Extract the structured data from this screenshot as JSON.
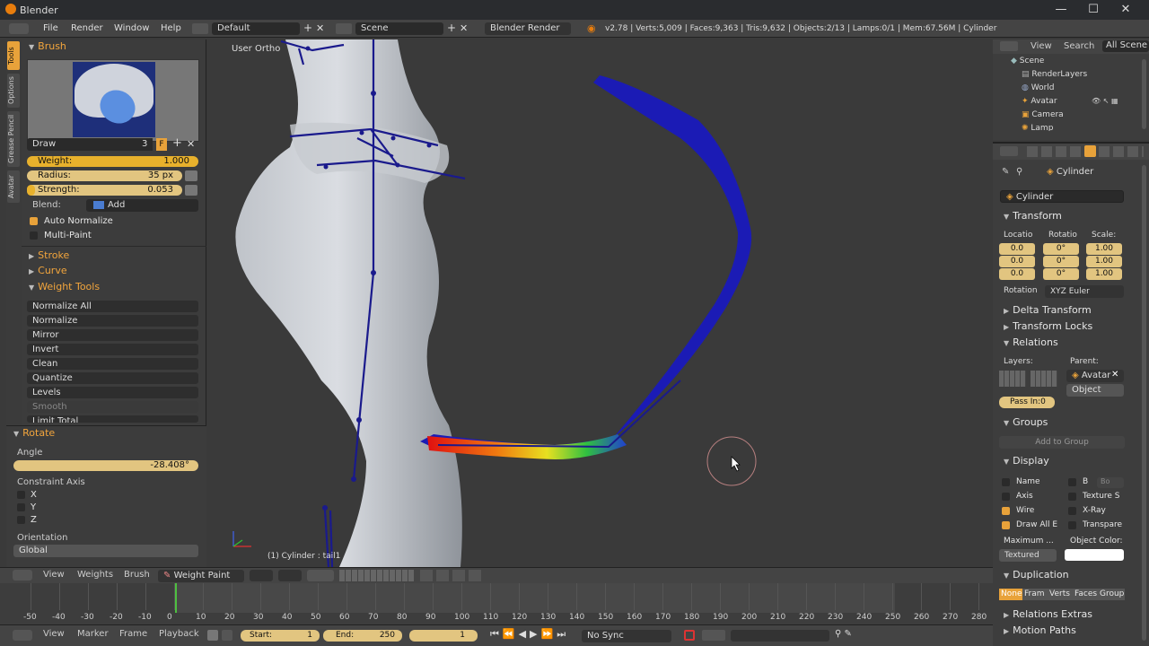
{
  "window": {
    "title": "Blender",
    "minimize": "—",
    "maximize": "☐",
    "close": "✕"
  },
  "topmenu": {
    "items": [
      "File",
      "Render",
      "Window",
      "Help"
    ],
    "layout": "Default",
    "scene": "Scene",
    "engine": "Blender Render",
    "stats": "v2.78 | Verts:5,009 | Faces:9,363 | Tris:9,632 | Objects:2/13 | Lamps:0/1 | Mem:67.56M | Cylinder"
  },
  "lefttabs": [
    "Tools",
    "Options",
    "Grease Pencil",
    "Avatar"
  ],
  "brush": {
    "header": "Brush",
    "name": "Draw",
    "users": "3",
    "fake": "F",
    "weight_label": "Weight:",
    "weight_value": "1.000",
    "weight_fill": 1.0,
    "radius_label": "Radius:",
    "radius_value": "35 px",
    "strength_label": "Strength:",
    "strength_value": "0.053",
    "strength_fill": 0.053,
    "blend_label": "Blend:",
    "blend_value": "Add",
    "auto_normalize": "Auto Normalize",
    "multi_paint": "Multi-Paint"
  },
  "sections": {
    "stroke": "Stroke",
    "curve": "Curve",
    "weight_tools": "Weight Tools"
  },
  "weight_tools": [
    "Normalize All",
    "Normalize",
    "Mirror",
    "Invert",
    "Clean",
    "Quantize",
    "Levels",
    "Smooth",
    "Limit Total"
  ],
  "rotate": {
    "header": "Rotate",
    "angle_label": "Angle",
    "angle_value": "-28.408°",
    "constraint_label": "Constraint Axis",
    "axes": [
      "X",
      "Y",
      "Z"
    ],
    "orientation_label": "Orientation",
    "orientation_value": "Global"
  },
  "viewport": {
    "view_label": "User Ortho",
    "object_label": "(1) Cylinder : tail1"
  },
  "outliner": {
    "view": "View",
    "search": "Search",
    "all_scenes": "All Scene",
    "items": [
      "Scene",
      "RenderLayers",
      "World",
      "Avatar",
      "Camera",
      "Lamp"
    ]
  },
  "props": {
    "object_name": "Cylinder",
    "name_field": "Cylinder",
    "transform": "Transform",
    "location_label": "Locatio",
    "rotation_label": "Rotatio",
    "scale_label": "Scale:",
    "loc": [
      "0.0",
      "0.0",
      "0.0"
    ],
    "rot": [
      "0°",
      "0°",
      "0°"
    ],
    "scale": [
      "1.00",
      "1.00",
      "1.00"
    ],
    "rotation_mode_label": "Rotation",
    "rotation_mode": "XYZ Euler",
    "delta": "Delta Transform",
    "locks": "Transform Locks",
    "relations": "Relations",
    "layers_label": "Layers:",
    "parent_label": "Parent:",
    "parent": "Avatar",
    "parent_type": "Object",
    "pass_index": "Pass In:0",
    "groups": "Groups",
    "add_group": "Add to Group",
    "display": "Display",
    "disp_left": [
      "Name",
      "Axis",
      "Wire",
      "Draw All E"
    ],
    "disp_right": [
      "B",
      "Texture S",
      "X-Ray",
      "Transpare"
    ],
    "bounds": "Bo",
    "max_label": "Maximum ...",
    "color_label": "Object Color:",
    "max_value": "Textured",
    "duplication": "Duplication",
    "dup_options": [
      "None",
      "Fram",
      "Verts",
      "Faces",
      "Group"
    ],
    "relations_extras": "Relations Extras",
    "motion_paths": "Motion Paths"
  },
  "viewheader": {
    "view": "View",
    "weights": "Weights",
    "brush": "Brush",
    "mode": "Weight Paint"
  },
  "timeline": {
    "ticks": [
      "-50",
      "-40",
      "-30",
      "-20",
      "-10",
      "0",
      "10",
      "20",
      "30",
      "40",
      "50",
      "60",
      "70",
      "80",
      "90",
      "100",
      "110",
      "120",
      "130",
      "140",
      "150",
      "160",
      "170",
      "180",
      "190",
      "200",
      "210",
      "220",
      "230",
      "240",
      "250",
      "260",
      "270",
      "280"
    ]
  },
  "playbar": {
    "view": "View",
    "marker": "Marker",
    "frame": "Frame",
    "playback": "Playback",
    "start_label": "Start:",
    "start": "1",
    "end_label": "End:",
    "end": "250",
    "current": "1",
    "sync": "No Sync"
  },
  "colors": {
    "accent": "#e8a23a",
    "slider": "#e8b12c",
    "bone": "#1a1a8c",
    "tail": "#1b1bb5"
  }
}
